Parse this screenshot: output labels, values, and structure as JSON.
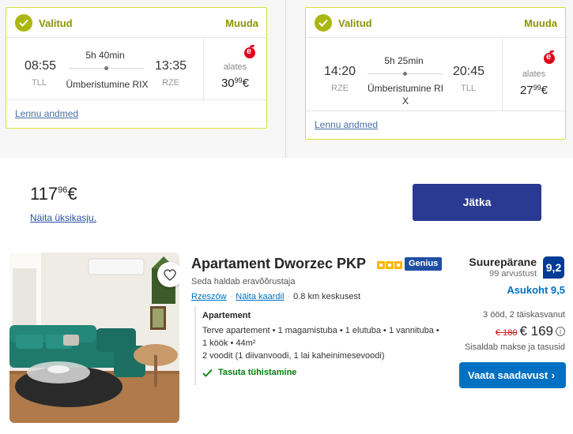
{
  "outbound": {
    "status": "Valitud",
    "change_label": "Muuda",
    "depart_time": "08:55",
    "depart_code": "TLL",
    "duration": "5h 40min",
    "transfer": "Ümberistumine RIX",
    "arrive_time": "13:35",
    "arrive_code": "RZE",
    "from_label": "alates",
    "price_main": "30",
    "price_cents": "99",
    "currency": "€",
    "details_link": "Lennu andmed"
  },
  "inbound": {
    "status": "Valitud",
    "change_label": "Muuda",
    "depart_time": "14:20",
    "depart_code": "RZE",
    "duration": "5h 25min",
    "transfer_line1": "Ümberistumine RI",
    "transfer_line2": "X",
    "arrive_time": "20:45",
    "arrive_code": "TLL",
    "from_label": "alates",
    "price_main": "27",
    "price_cents": "99",
    "currency": "€",
    "details_link": "Lennu andmed"
  },
  "total": {
    "price_main": "117",
    "price_cents": "96",
    "currency": "€",
    "breakdown_link": "Näita üksikasju.",
    "continue_label": "Jätka"
  },
  "hotel": {
    "name": "Apartament Dworzec PKP",
    "genius_label": "Genius",
    "star_count": 3,
    "managed_by": "Seda haldab eravõõrustaja",
    "city_link": "Rzeszów",
    "map_link": "Näita kaardil",
    "distance": "0.8 km keskusest",
    "room_type": "Apartement",
    "room_line1": "Terve apartement • 1 magamistuba • 1 elutuba • 1 vannituba •",
    "room_line2": "1 köök • 44m²",
    "beds": "2 voodit (1 diivanvoodi, 1 lai kaheinimesevoodi)",
    "cancellation": "Tasuta tühistamine",
    "rating_word": "Suurepärane",
    "reviews": "99 arvustust",
    "score": "9,2",
    "location_score": "Asukoht 9,5",
    "stay": "3 ööd, 2 täiskasvanut",
    "old_price": "€ 180",
    "price": "€ 169",
    "info_symbol": "i",
    "taxes": "Sisaldab makse ja tasusid",
    "availability_label": "Vaata saadavust",
    "availability_chevron": "›"
  },
  "colors": {
    "selected_accent": "#aab70e",
    "selected_border": "#d6e03a",
    "airline_red": "#e2001a",
    "continue_button": "#2a3991",
    "hotel_blue": "#0071c2",
    "score_blue": "#003b95",
    "free_cancel_green": "#008009",
    "old_price_red": "#d4111e",
    "star_gold": "#ffb700"
  },
  "icons": {
    "selected": "check-icon",
    "airline": "airline-logo-icon",
    "stop": "dot-icon",
    "favorite": "heart-icon",
    "info": "info-icon",
    "cancellation": "check-icon",
    "button": "chevron-right-icon"
  }
}
